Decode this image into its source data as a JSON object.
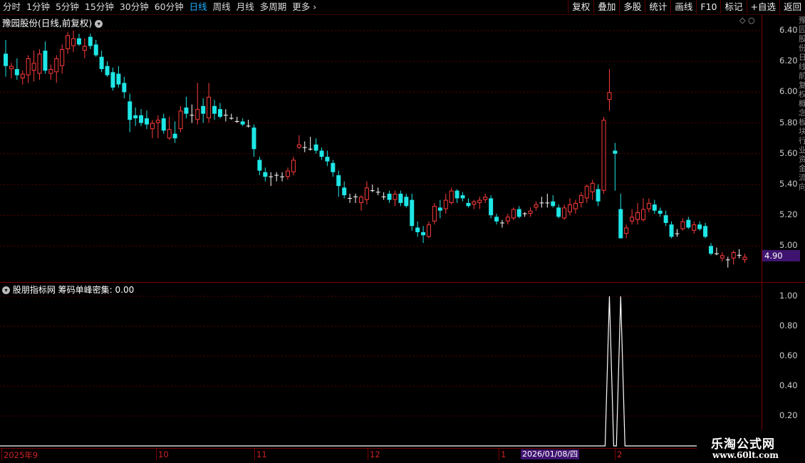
{
  "toolbar": {
    "periods": [
      "分时",
      "1分钟",
      "5分钟",
      "15分钟",
      "30分钟",
      "60分钟",
      "日线",
      "周线",
      "月线",
      "多周期",
      "更多"
    ],
    "active_period": "日线",
    "more_icon": "chevron-right-icon",
    "buttons": [
      "复权",
      "叠加",
      "多股",
      "统计",
      "画线",
      "F10",
      "标记",
      "+自选",
      "返回"
    ]
  },
  "chart": {
    "title": "豫园股份(日线,前复权)",
    "price_axis": [
      "6.40",
      "6.20",
      "6.00",
      "5.80",
      "5.60",
      "5.40",
      "5.20",
      "5.00"
    ],
    "last_price": "4.90",
    "colors": {
      "up": "#ff3c3c",
      "down": "#1ee6e6",
      "grid": "#5a0000",
      "line": "#ffffff"
    }
  },
  "indicator": {
    "title": "股朋指标网 筹码单峰密集: 0.00",
    "axis": [
      "1.00",
      "0.80",
      "0.60",
      "0.40",
      "0.20"
    ]
  },
  "xaxis": {
    "labels": [
      "2025年9",
      "10",
      "11",
      "12",
      "1",
      "2"
    ],
    "cursor_date": "2026/01/08/四"
  },
  "watermark": {
    "line1": "乐淘公式网",
    "line2": "www.60lt.com"
  },
  "chart_data": {
    "type": "candlestick",
    "ylim": [
      4.78,
      6.48
    ],
    "candles": [
      [
        6.25,
        6.34,
        6.1,
        6.17
      ],
      [
        6.15,
        6.19,
        6.09,
        6.17
      ],
      [
        6.15,
        6.22,
        6.08,
        6.11
      ],
      [
        6.09,
        6.14,
        6.05,
        6.12
      ],
      [
        6.11,
        6.24,
        6.06,
        6.22
      ],
      [
        6.14,
        6.27,
        6.07,
        6.19
      ],
      [
        6.12,
        6.28,
        6.08,
        6.25
      ],
      [
        6.27,
        6.33,
        6.12,
        6.14
      ],
      [
        6.12,
        6.18,
        6.08,
        6.15
      ],
      [
        6.13,
        6.24,
        6.06,
        6.22
      ],
      [
        6.17,
        6.31,
        6.12,
        6.28
      ],
      [
        6.28,
        6.39,
        6.25,
        6.37
      ],
      [
        6.3,
        6.4,
        6.26,
        6.35
      ],
      [
        6.35,
        6.38,
        6.3,
        6.31
      ],
      [
        6.27,
        6.35,
        6.22,
        6.3
      ],
      [
        6.36,
        6.38,
        6.28,
        6.3
      ],
      [
        6.31,
        6.34,
        6.23,
        6.24
      ],
      [
        6.23,
        6.27,
        6.13,
        6.15
      ],
      [
        6.17,
        6.2,
        6.1,
        6.11
      ],
      [
        6.13,
        6.16,
        6.01,
        6.03
      ],
      [
        6.12,
        6.17,
        6.03,
        6.05
      ],
      [
        6.06,
        6.1,
        5.96,
        6.0
      ],
      [
        5.94,
        5.99,
        5.74,
        5.82
      ],
      [
        5.85,
        5.9,
        5.78,
        5.83
      ],
      [
        5.85,
        5.89,
        5.78,
        5.8
      ],
      [
        5.83,
        5.88,
        5.76,
        5.79
      ],
      [
        5.76,
        5.82,
        5.7,
        5.8
      ],
      [
        5.8,
        5.85,
        5.7,
        5.82
      ],
      [
        5.83,
        5.86,
        5.73,
        5.75
      ],
      [
        5.7,
        5.84,
        5.69,
        5.76
      ],
      [
        5.73,
        5.81,
        5.67,
        5.7
      ],
      [
        5.76,
        5.91,
        5.74,
        5.88
      ],
      [
        5.9,
        5.97,
        5.83,
        5.86
      ],
      [
        5.86,
        5.92,
        5.8,
        5.85
      ],
      [
        5.82,
        6.06,
        5.79,
        5.89
      ],
      [
        5.91,
        5.96,
        5.8,
        5.86
      ],
      [
        5.83,
        6.06,
        5.8,
        5.97
      ],
      [
        5.91,
        5.95,
        5.82,
        5.86
      ],
      [
        5.89,
        5.93,
        5.83,
        5.84
      ],
      [
        5.86,
        5.89,
        5.81,
        5.85
      ],
      [
        5.84,
        5.86,
        5.82,
        5.83
      ],
      [
        5.82,
        5.84,
        5.8,
        5.81
      ],
      [
        5.81,
        5.83,
        5.78,
        5.79
      ],
      [
        5.79,
        5.82,
        5.77,
        5.78
      ],
      [
        5.77,
        5.79,
        5.58,
        5.63
      ],
      [
        5.56,
        5.58,
        5.46,
        5.49
      ],
      [
        5.48,
        5.51,
        5.42,
        5.45
      ],
      [
        5.44,
        5.48,
        5.39,
        5.45
      ],
      [
        5.45,
        5.48,
        5.42,
        5.46
      ],
      [
        5.44,
        5.48,
        5.42,
        5.45
      ],
      [
        5.45,
        5.51,
        5.43,
        5.49
      ],
      [
        5.48,
        5.58,
        5.46,
        5.56
      ],
      [
        5.64,
        5.72,
        5.63,
        5.66
      ],
      [
        5.65,
        5.68,
        5.61,
        5.64
      ],
      [
        5.64,
        5.71,
        5.62,
        5.63
      ],
      [
        5.66,
        5.7,
        5.6,
        5.62
      ],
      [
        5.62,
        5.64,
        5.56,
        5.58
      ],
      [
        5.58,
        5.62,
        5.52,
        5.55
      ],
      [
        5.54,
        5.56,
        5.45,
        5.48
      ],
      [
        5.46,
        5.49,
        5.32,
        5.39
      ],
      [
        5.38,
        5.42,
        5.31,
        5.33
      ],
      [
        5.32,
        5.34,
        5.28,
        5.31
      ],
      [
        5.31,
        5.34,
        5.28,
        5.32
      ],
      [
        5.28,
        5.33,
        5.23,
        5.32
      ],
      [
        5.3,
        5.42,
        5.27,
        5.38
      ],
      [
        5.37,
        5.4,
        5.35,
        5.36
      ],
      [
        5.36,
        5.38,
        5.33,
        5.35
      ],
      [
        5.33,
        5.35,
        5.3,
        5.32
      ],
      [
        5.34,
        5.36,
        5.28,
        5.3
      ],
      [
        5.3,
        5.36,
        5.26,
        5.34
      ],
      [
        5.34,
        5.36,
        5.26,
        5.28
      ],
      [
        5.32,
        5.34,
        5.25,
        5.26
      ],
      [
        5.3,
        5.34,
        5.1,
        5.13
      ],
      [
        5.12,
        5.16,
        5.06,
        5.09
      ],
      [
        5.09,
        5.13,
        5.02,
        5.07
      ],
      [
        5.06,
        5.16,
        5.05,
        5.14
      ],
      [
        5.16,
        5.28,
        5.14,
        5.26
      ],
      [
        5.25,
        5.3,
        5.18,
        5.23
      ],
      [
        5.24,
        5.34,
        5.21,
        5.3
      ],
      [
        5.28,
        5.38,
        5.27,
        5.36
      ],
      [
        5.36,
        5.37,
        5.28,
        5.31
      ],
      [
        5.33,
        5.35,
        5.29,
        5.31
      ],
      [
        5.28,
        5.31,
        5.25,
        5.26
      ],
      [
        5.27,
        5.3,
        5.24,
        5.29
      ],
      [
        5.28,
        5.32,
        5.24,
        5.3
      ],
      [
        5.3,
        5.34,
        5.28,
        5.32
      ],
      [
        5.31,
        5.33,
        5.18,
        5.2
      ],
      [
        5.19,
        5.21,
        5.14,
        5.16
      ],
      [
        5.14,
        5.17,
        5.12,
        5.15
      ],
      [
        5.16,
        5.21,
        5.14,
        5.19
      ],
      [
        5.18,
        5.25,
        5.17,
        5.24
      ],
      [
        5.24,
        5.26,
        5.18,
        5.19
      ],
      [
        5.2,
        5.22,
        5.19,
        5.21
      ],
      [
        5.21,
        5.25,
        5.19,
        5.23
      ],
      [
        5.25,
        5.29,
        5.23,
        5.27
      ],
      [
        5.27,
        5.32,
        5.25,
        5.28
      ],
      [
        5.28,
        5.34,
        5.25,
        5.28
      ],
      [
        5.29,
        5.33,
        5.25,
        5.26
      ],
      [
        5.25,
        5.27,
        5.18,
        5.19
      ],
      [
        5.18,
        5.27,
        5.17,
        5.25
      ],
      [
        5.22,
        5.31,
        5.2,
        5.27
      ],
      [
        5.24,
        5.3,
        5.21,
        5.28
      ],
      [
        5.28,
        5.35,
        5.25,
        5.33
      ],
      [
        5.31,
        5.4,
        5.28,
        5.39
      ],
      [
        5.35,
        5.43,
        5.3,
        5.41
      ],
      [
        5.37,
        5.4,
        5.26,
        5.29
      ],
      [
        5.36,
        5.84,
        5.34,
        5.82
      ],
      [
        5.95,
        6.15,
        5.88,
        6.0
      ],
      [
        5.62,
        5.67,
        5.36,
        5.6
      ],
      [
        5.24,
        5.34,
        5.05,
        5.05
      ],
      [
        5.08,
        5.14,
        5.05,
        5.12
      ],
      [
        5.16,
        5.24,
        5.14,
        5.19
      ],
      [
        5.17,
        5.28,
        5.14,
        5.22
      ],
      [
        5.17,
        5.31,
        5.16,
        5.24
      ],
      [
        5.24,
        5.31,
        5.22,
        5.28
      ],
      [
        5.27,
        5.3,
        5.21,
        5.23
      ],
      [
        5.23,
        5.25,
        5.19,
        5.21
      ],
      [
        5.2,
        5.23,
        5.13,
        5.15
      ],
      [
        5.14,
        5.16,
        5.05,
        5.06
      ],
      [
        5.08,
        5.11,
        5.06,
        5.08
      ],
      [
        5.11,
        5.18,
        5.1,
        5.16
      ],
      [
        5.17,
        5.19,
        5.11,
        5.12
      ],
      [
        5.1,
        5.16,
        5.08,
        5.14
      ],
      [
        5.14,
        5.16,
        5.1,
        5.11
      ],
      [
        5.13,
        5.15,
        5.05,
        5.06
      ],
      [
        5.0,
        5.02,
        4.94,
        4.95
      ],
      [
        4.96,
        4.99,
        4.94,
        4.95
      ],
      [
        4.92,
        4.96,
        4.9,
        4.94
      ],
      [
        4.91,
        4.93,
        4.86,
        4.91
      ],
      [
        4.92,
        4.97,
        4.88,
        4.96
      ],
      [
        4.95,
        4.98,
        4.92,
        4.94
      ],
      [
        4.91,
        4.95,
        4.89,
        4.93
      ]
    ],
    "indicator_series": {
      "name": "筹码单峰密集",
      "peaks_at_candle_index": [
        107,
        109
      ],
      "peak_value": 1.0,
      "ylim": [
        0,
        1.05
      ]
    }
  }
}
